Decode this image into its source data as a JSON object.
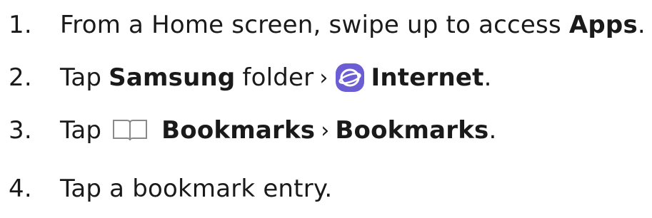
{
  "steps": [
    {
      "number": "1.",
      "parts": [
        "From a Home screen, swipe up to access ",
        "Apps",
        "."
      ]
    },
    {
      "number": "2.",
      "parts": [
        "Tap",
        "Samsung",
        "folder",
        "›",
        "Internet",
        "."
      ],
      "icon": "samsung-internet-icon"
    },
    {
      "number": "3.",
      "parts": [
        "Tap",
        "Bookmarks",
        "›",
        "Bookmarks",
        "."
      ],
      "icon": "bookmarks-book-icon"
    },
    {
      "number": "4.",
      "parts": [
        "Tap a bookmark entry."
      ]
    }
  ],
  "colors": {
    "text": "#1a1a1a",
    "internet_icon_fill": "#6b5dd3",
    "bookmark_icon_stroke": "#8a8a8a"
  }
}
